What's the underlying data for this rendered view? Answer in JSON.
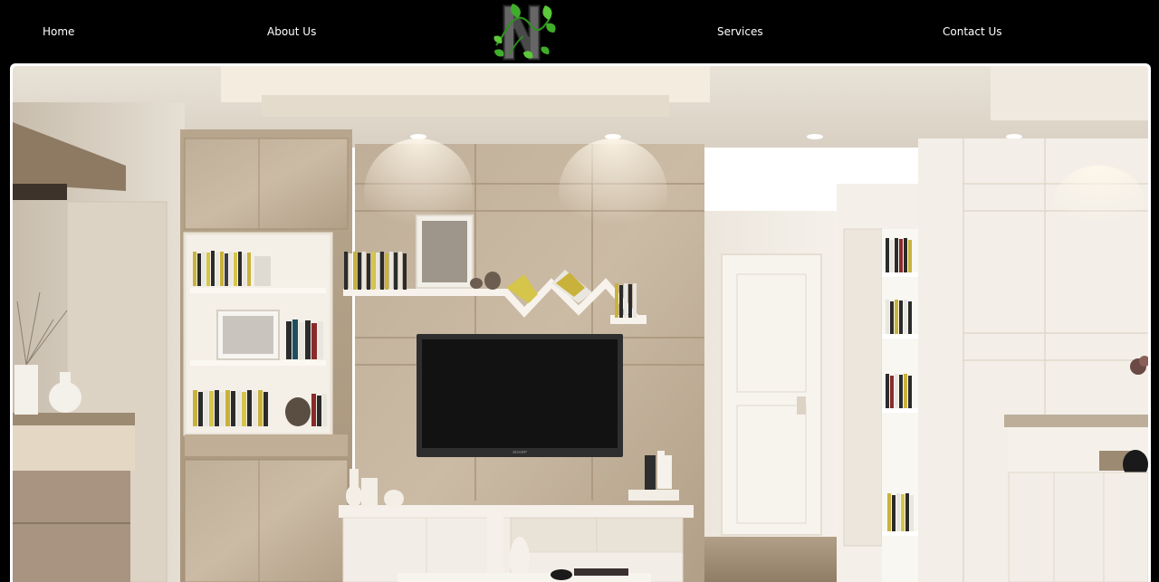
{
  "nav": {
    "items": [
      {
        "label": "Home"
      },
      {
        "label": "About Us"
      },
      {
        "label": "Services"
      },
      {
        "label": "Contact Us"
      }
    ]
  },
  "hero": {
    "tv_brand": "SHARP"
  },
  "colors": {
    "nav_bg": "#000000",
    "nav_text": "#ffffff",
    "logo_green": "#3fae2a"
  }
}
